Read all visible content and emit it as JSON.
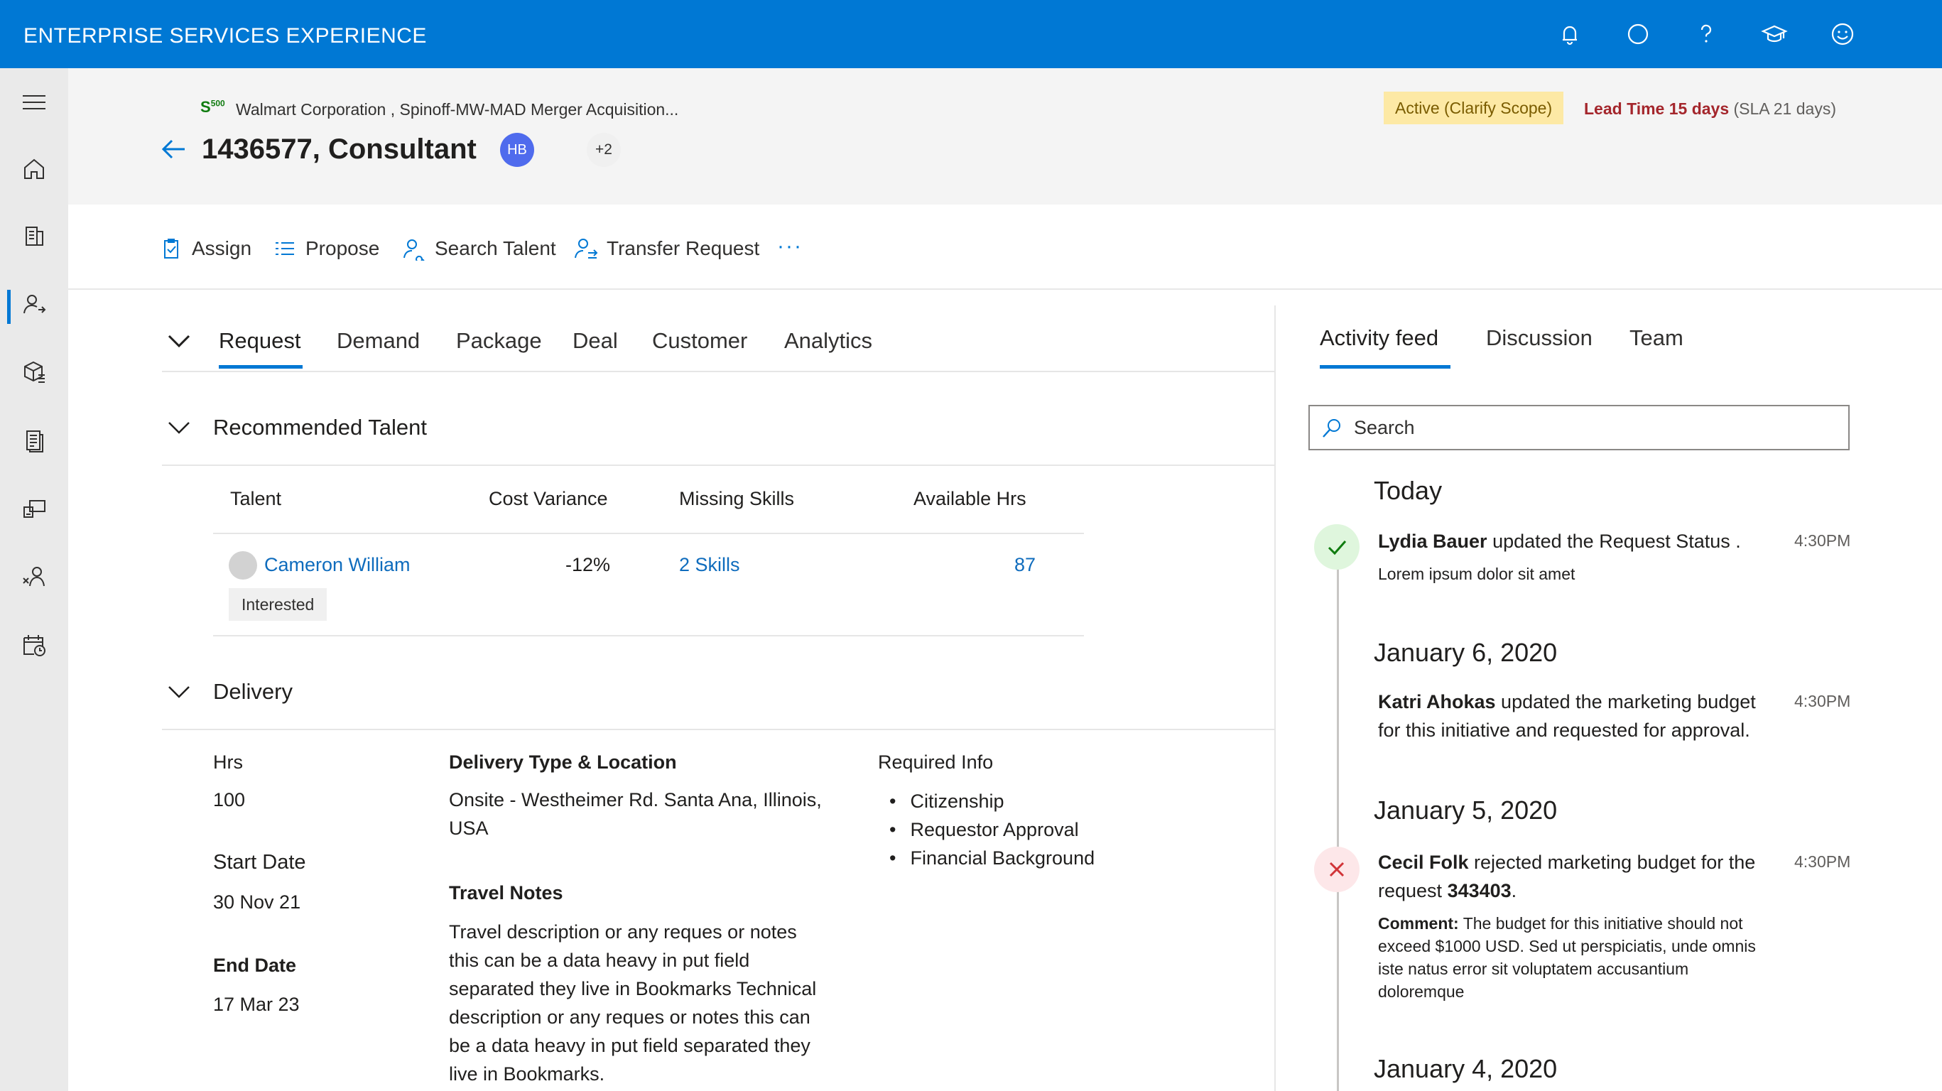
{
  "app": {
    "title": "ENTERPRISE SERVICES EXPERIENCE"
  },
  "topbar_icons": [
    "bell-icon",
    "circle-icon",
    "help-icon",
    "learning-icon",
    "feedback-icon"
  ],
  "nav_icons": [
    "hamburger-icon",
    "home-icon",
    "requests-icon",
    "people-icon",
    "package-icon",
    "document-icon",
    "devices-icon",
    "talent-icon",
    "calendar-icon"
  ],
  "header": {
    "badge_logo": "S",
    "badge_logo_sup": "500",
    "breadcrumb": "Walmart Corporation , Spinoff-MW-MAD Merger Acquisition...",
    "title": "1436577, Consultant",
    "avatar_initials": "HB",
    "avatar_more": "+2",
    "status": "Active (Clarify Scope)",
    "lead_time": "Lead Time 15 days",
    "sla": "(SLA 21 days)"
  },
  "toolbar": {
    "assign": "Assign",
    "propose": "Propose",
    "search_talent": "Search Talent",
    "transfer_request": "Transfer Request",
    "more": "···"
  },
  "tabs": [
    "Request",
    "Demand",
    "Package",
    "Deal",
    "Customer",
    "Analytics"
  ],
  "recommended": {
    "title": "Recommended Talent",
    "columns": [
      "Talent",
      "Cost Variance",
      "Missing Skills",
      "Available Hrs"
    ],
    "row": {
      "name": "Cameron William",
      "status": "Interested",
      "cost_variance": "-12%",
      "missing_skills": "2 Skills",
      "available_hrs": "87"
    }
  },
  "delivery": {
    "title": "Delivery",
    "hrs_label": "Hrs",
    "hrs_value": "100",
    "start_label": "Start Date",
    "start_value": "30 Nov 21",
    "end_label": "End Date",
    "end_value": "17 Mar 23",
    "type_label": "Delivery Type & Location",
    "type_value_1": "Onsite - Westheimer Rd. Santa Ana, Illinois,",
    "type_value_2": "USA",
    "travel_label": "Travel Notes",
    "travel_lines": [
      "Travel description or any reques or notes",
      "this can be a data heavy in put field",
      "separated they live in Bookmarks Technical",
      "description or any reques or notes this can",
      "be a data heavy in put field separated they",
      "live in Bookmarks."
    ],
    "required_label": "Required Info",
    "required_items": [
      "Citizenship",
      "Requestor Approval",
      "Financial Background"
    ]
  },
  "feed": {
    "tabs": [
      "Activity feed",
      "Discussion",
      "Team"
    ],
    "search_placeholder": "Search",
    "days": [
      "Today",
      "January 6, 2020",
      "January 5, 2020",
      "January 4, 2020"
    ],
    "items": [
      {
        "actor": "Lydia Bauer",
        "text": " updated the Request Status .",
        "sub": "Lorem ipsum dolor sit amet",
        "time": "4:30PM"
      },
      {
        "actor": "Katri Ahokas",
        "text": " updated the marketing budget",
        "text2": "for this initiative and requested for approval.",
        "time": "4:30PM"
      },
      {
        "actor": "Cecil Folk",
        "text": " rejected marketing budget for the",
        "text2_pre": "request ",
        "text2_num": "343403",
        "text2_post": ".",
        "comment_label": "Comment:",
        "comment_1": " The budget for this initiative should not",
        "comment_2": "exceed $1000 USD. Sed ut perspiciatis, unde omnis",
        "comment_3": "iste natus error sit voluptatem accusantium",
        "comment_4": "doloremque",
        "time": "4:30PM"
      }
    ]
  },
  "colors": {
    "accent": "#0078d4",
    "status_bg": "#fde9a5",
    "danger": "#a4262c",
    "success": "#107c10"
  }
}
